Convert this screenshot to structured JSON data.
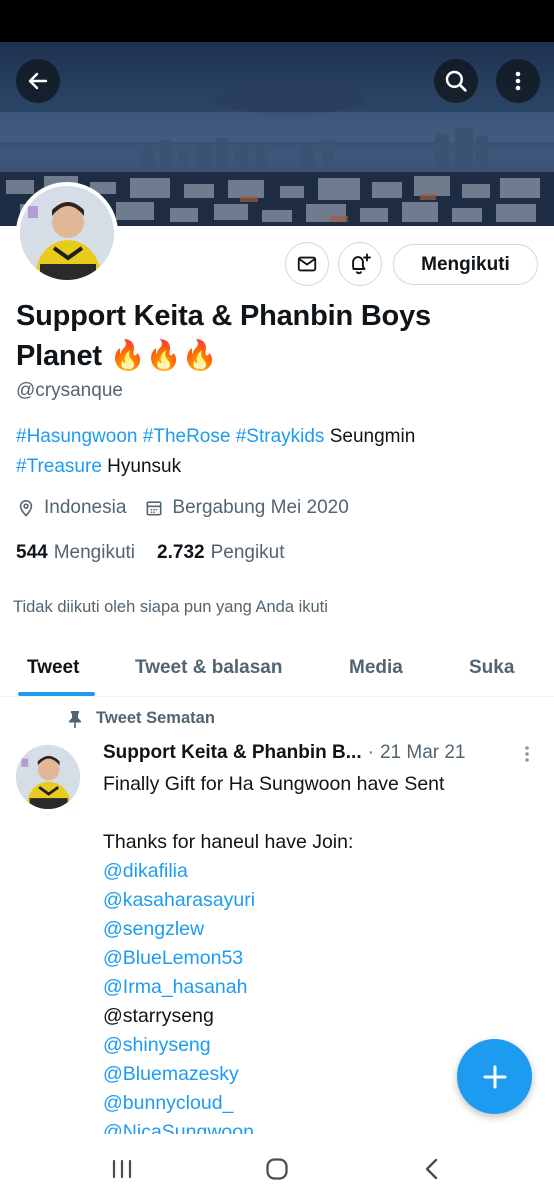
{
  "header": {
    "back_icon": "arrow-left-icon",
    "search_icon": "search-icon",
    "more_icon": "more-vertical-icon"
  },
  "profile": {
    "name": "Support Keita & Phanbin Boys Planet",
    "name_emoji": "🔥🔥🔥",
    "handle": "@crysanque",
    "follow_button_label": "Mengikuti",
    "bio": {
      "line1": [
        {
          "text": "#Hasungwoon",
          "type": "link"
        },
        {
          "text": " ",
          "type": "text"
        },
        {
          "text": "#TheRose",
          "type": "link"
        },
        {
          "text": " ",
          "type": "text"
        },
        {
          "text": "#Straykids",
          "type": "link"
        },
        {
          "text": " Seungmin",
          "type": "text"
        }
      ],
      "line2": [
        {
          "text": "#Treasure",
          "type": "link"
        },
        {
          "text": " Hyunsuk",
          "type": "text"
        }
      ]
    },
    "location": "Indonesia",
    "joined": "Bergabung Mei 2020",
    "following_count": "544",
    "following_label": "Mengikuti",
    "followers_count": "2.732",
    "followers_label": "Pengikut",
    "not_followed_text": "Tidak diikuti oleh siapa pun yang Anda ikuti"
  },
  "tabs": [
    {
      "label": "Tweet",
      "active": true
    },
    {
      "label": "Tweet & balasan",
      "active": false
    },
    {
      "label": "Media",
      "active": false
    },
    {
      "label": "Suka",
      "active": false
    }
  ],
  "pinned_tweet": {
    "pinned_label": "Tweet Sematan",
    "author": "Support Keita & Phanbin B...",
    "separator": "·",
    "date": "21 Mar 21",
    "lines": [
      {
        "text": "Finally Gift for Ha Sungwoon have Sent",
        "type": "text"
      },
      {
        "text": "",
        "type": "text"
      },
      {
        "text": "Thanks for haneul have Join:",
        "type": "text"
      },
      {
        "text": "@dikafilia",
        "type": "mention"
      },
      {
        "text": "@kasaharasayuri",
        "type": "mention"
      },
      {
        "text": "@sengzlew",
        "type": "mention"
      },
      {
        "text": "@BlueLemon53",
        "type": "mention"
      },
      {
        "text": "@Irma_hasanah",
        "type": "mention"
      },
      {
        "text": "@starryseng",
        "type": "text"
      },
      {
        "text": "@shinyseng",
        "type": "mention"
      },
      {
        "text": "@Bluemazesky",
        "type": "mention"
      },
      {
        "text": "@bunnycloud_",
        "type": "mention"
      },
      {
        "text": "@NicaSungwoon",
        "type": "mention"
      }
    ]
  },
  "colors": {
    "accent": "#1d9bf0",
    "text_primary": "#0f1419",
    "text_secondary": "#536471",
    "border": "#cfd9de"
  }
}
